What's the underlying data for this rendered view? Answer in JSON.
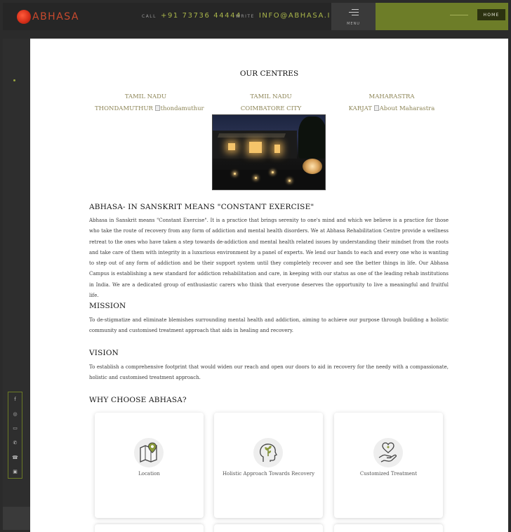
{
  "header": {
    "logo_text": "ABHASA",
    "call_label": "CALL",
    "call_value": "+91 73736 44444",
    "write_label": "WRITE",
    "write_value": "INFO@ABHASA.IN",
    "menu_label": "MENU",
    "home_label": "HOME"
  },
  "social": {
    "items": [
      {
        "name": "facebook-icon",
        "glyph": "f"
      },
      {
        "name": "instagram-icon",
        "glyph": "◎"
      },
      {
        "name": "youtube-icon",
        "glyph": "▭"
      },
      {
        "name": "whatsapp-icon",
        "glyph": "✆"
      },
      {
        "name": "phone-icon",
        "glyph": "☎"
      },
      {
        "name": "gallery-icon",
        "glyph": "▣"
      }
    ]
  },
  "centres": {
    "title": "OUR CENTRES",
    "items": [
      {
        "state": "TAMIL NADU",
        "city": "THONDAMUTHUR",
        "img_alt": "thondamuthur"
      },
      {
        "state": "TAMIL NADU",
        "city": "COIMBATORE CITY",
        "img_alt": ""
      },
      {
        "state": "MAHARASTRA",
        "city": "KARJAT",
        "img_alt": "About Maharastra"
      }
    ]
  },
  "about": {
    "heading": "ABHASA- IN SANSKRIT MEANS \"CONSTANT EXERCISE\"",
    "text": "Abhasa in Sanskrit means \"Constant Exercise\". It is a practice that brings serenity to one's mind and which we believe is a practice for those who take the route of recovery from any form of addiction and mental health disorders. We at Abhasa Rehabilitation Centre provide a wellness retreat to the ones who have taken a step towards de-addiction and mental health related issues by understanding their mindset from the roots and take care of them with integrity in a luxurious environment by a panel of experts. We lend our hands to each and every one who is wanting to step out of any form of addiction and be their support system until they completely recover and see the better things in life. Our Abhasa Campus is establishing a new standard for addiction rehabilitation and care, in keeping with our status as one of the leading rehab institutions in India. We are a dedicated group of enthusiastic carers who think that everyone deserves the opportunity to live a meaningful and fruitful life."
  },
  "mission": {
    "heading": "MISSION",
    "text": "To de-stigmatize and eliminate blemishes surrounding mental health and addiction, aiming to achieve our purpose through building a holistic community and customised treatment approach that aids in healing and recovery."
  },
  "vision": {
    "heading": "VISION",
    "text": "To establish a comprehensive footprint that would widen our reach and open our doors to aid in recovery for the needy with a compassionate, holistic and customised treatment approach."
  },
  "why": {
    "heading": "WHY CHOOSE ABHASA?",
    "cards": [
      {
        "label": "Location",
        "icon": "map-pin-icon"
      },
      {
        "label": "Holistic Approach Towards Recovery",
        "icon": "head-plant-icon"
      },
      {
        "label": "Customized Treatment",
        "icon": "hand-heart-icon"
      }
    ]
  },
  "colors": {
    "accent_green": "#6d7d28",
    "accent_text_green": "#a9b54a",
    "brand_red": "#c94a2e",
    "dark_bg": "#262626"
  }
}
